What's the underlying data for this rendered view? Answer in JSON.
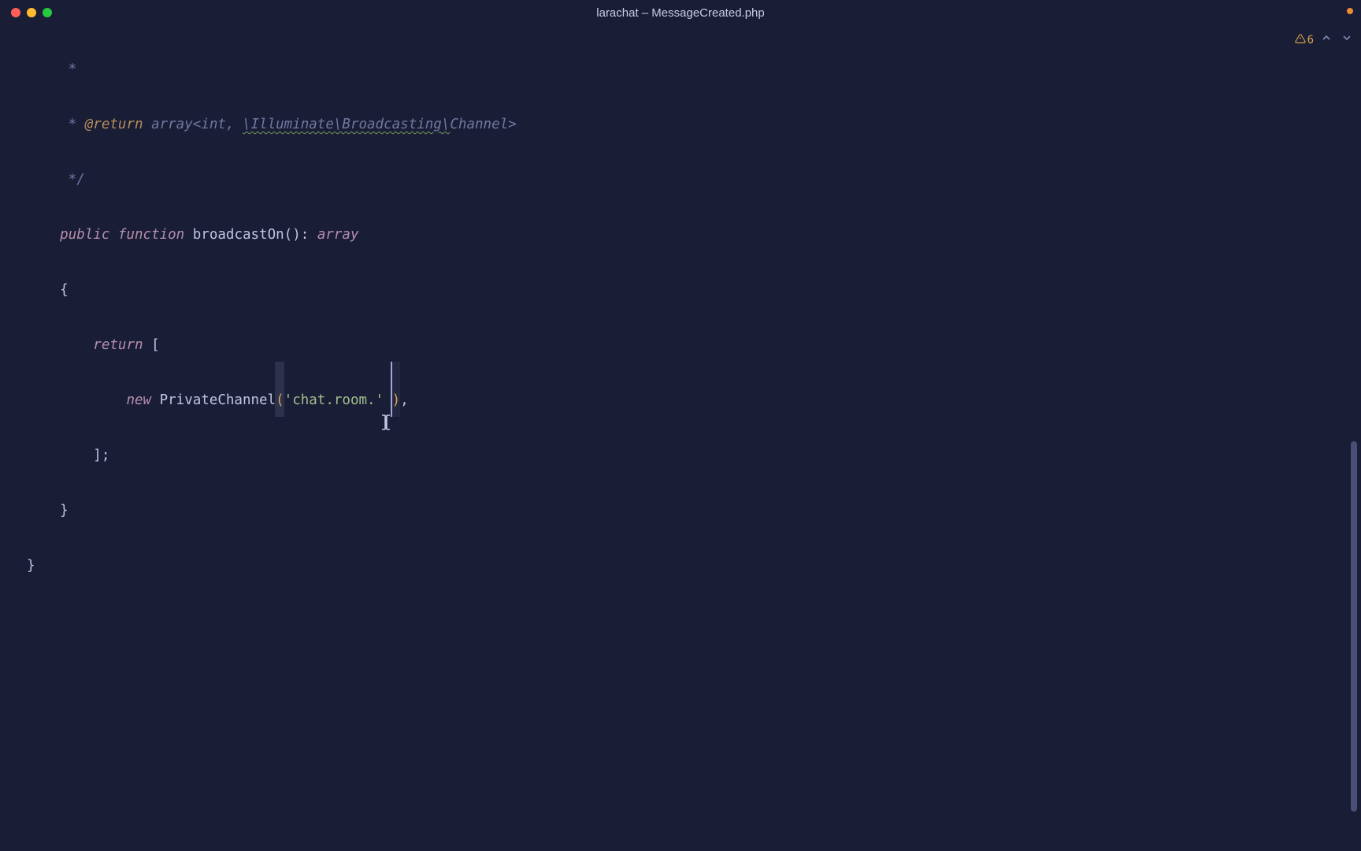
{
  "window": {
    "title": "larachat – MessageCreated.php"
  },
  "notifications": {
    "warning_count": "6"
  },
  "code": {
    "line1": {
      "star": "     *"
    },
    "line2": {
      "pre": "     * ",
      "annotation": "@return",
      "space": " ",
      "generic1": "array<int, ",
      "ns": "\\Illuminate\\Broadcasting\\",
      "generic2": "Channel>"
    },
    "line3": {
      "close": "     */"
    },
    "line4": {
      "indent": "    ",
      "kw1": "public",
      "sp1": " ",
      "kw2": "function",
      "sp2": " ",
      "name": "broadcastOn",
      "parens": "()",
      "colon": ": ",
      "ret": "array"
    },
    "line5": {
      "brace": "    {"
    },
    "line6": {
      "indent": "        ",
      "kw": "return",
      "sp": " ",
      "br": "["
    },
    "line7": {
      "indent": "            ",
      "new": "new",
      "sp": " ",
      "cls": "PrivateChannel",
      "open": "(",
      "str": "'chat.room.'",
      "sp2": " ",
      "close": ")",
      "comma": ","
    },
    "line8": {
      "close": "        ];"
    },
    "line9": {
      "brace": "    }"
    },
    "line10": {
      "brace": "}"
    }
  }
}
